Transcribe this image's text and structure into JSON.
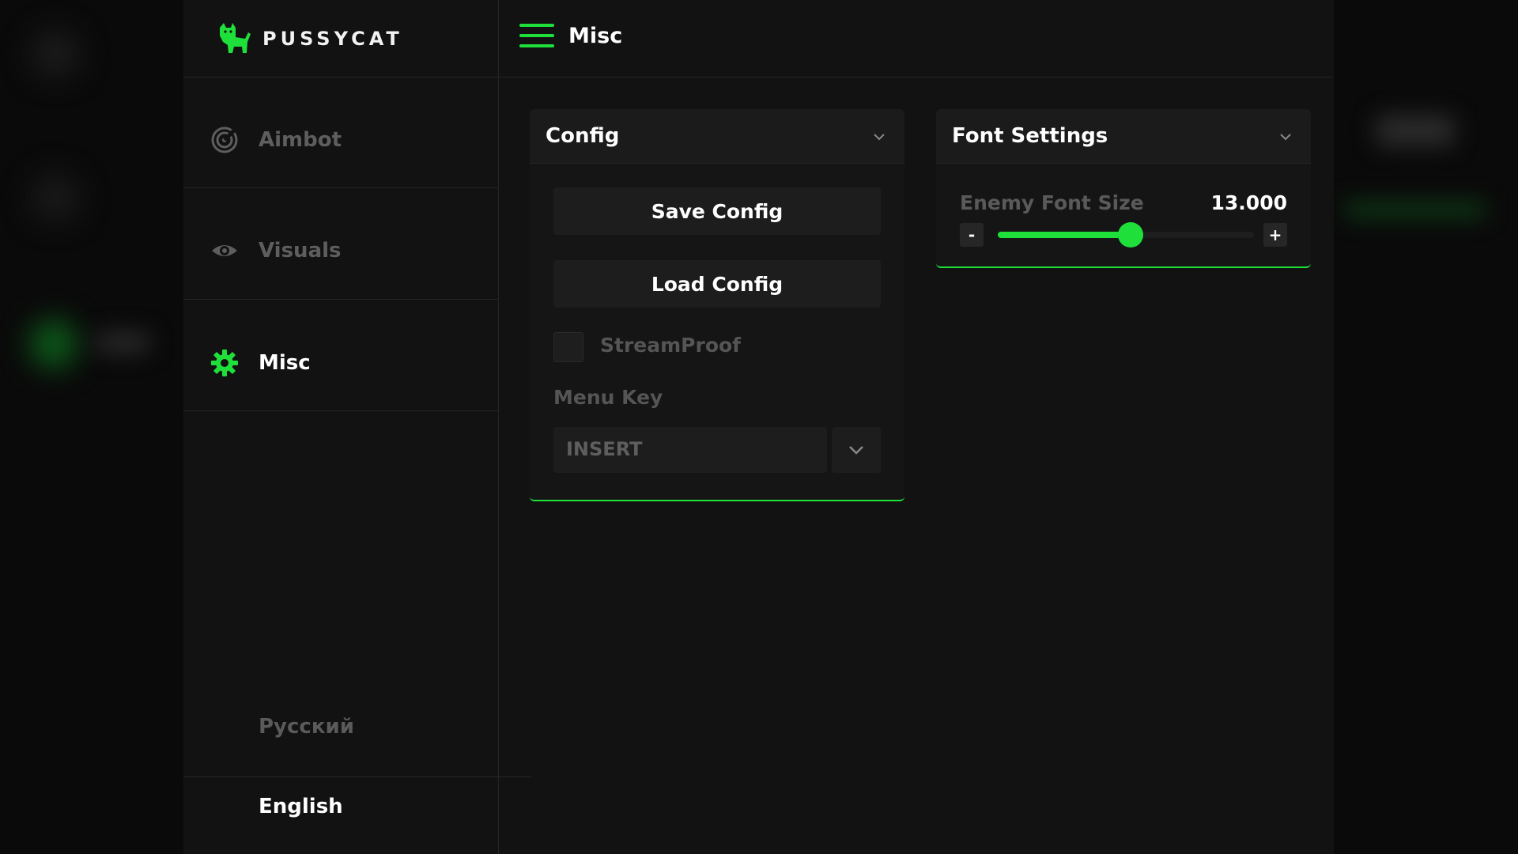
{
  "brand": {
    "name": "PUSSYCAT"
  },
  "colors": {
    "accent": "#1fe03a",
    "window_bg": "#121212",
    "card_bg": "#151515"
  },
  "sidebar": {
    "items": [
      {
        "label": "Aimbot",
        "icon": "target-icon",
        "active": false
      },
      {
        "label": "Visuals",
        "icon": "eye-icon",
        "active": false
      },
      {
        "label": "Misc",
        "icon": "gear-icon",
        "active": true
      }
    ],
    "languages": [
      {
        "label": "Русский",
        "active": false
      },
      {
        "label": "English",
        "active": true
      }
    ]
  },
  "header": {
    "title": "Misc"
  },
  "config_card": {
    "title": "Config",
    "save_label": "Save Config",
    "load_label": "Load Config",
    "streamproof_label": "StreamProof",
    "streamproof_checked": false,
    "menu_key_label": "Menu Key",
    "menu_key_value": "INSERT"
  },
  "font_card": {
    "title": "Font Settings",
    "slider_label": "Enemy Font Size",
    "slider_value_text": "13.000",
    "slider_fraction": 0.52,
    "minus_label": "-",
    "plus_label": "+"
  }
}
